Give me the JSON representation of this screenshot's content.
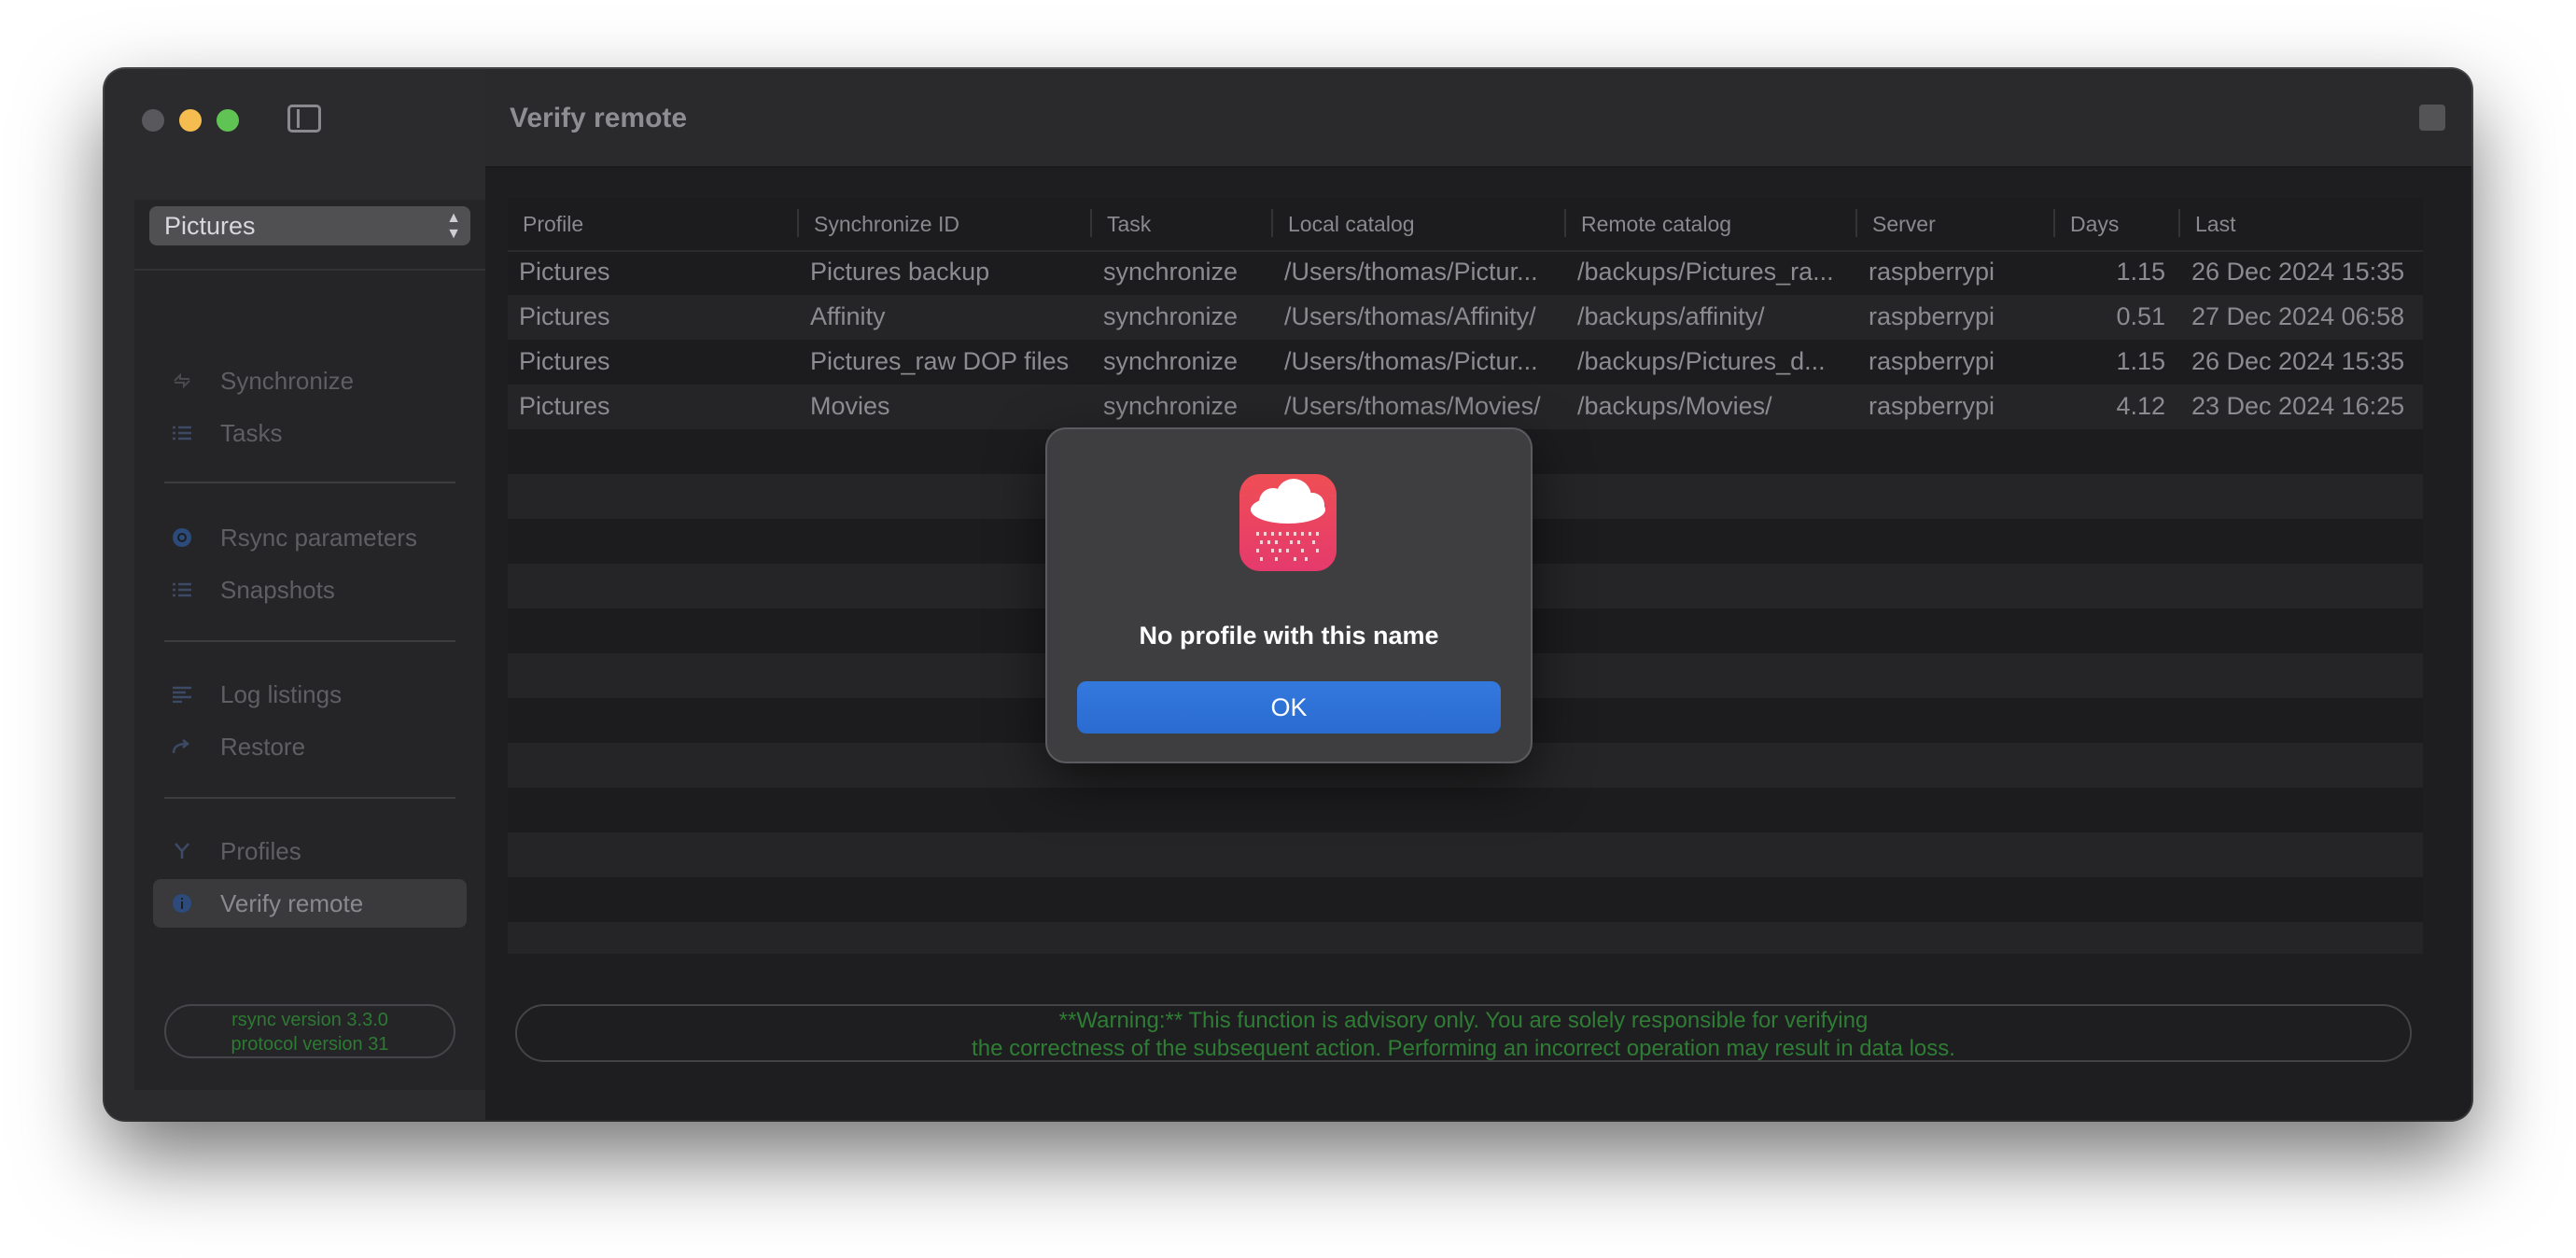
{
  "window": {
    "title": "Verify remote"
  },
  "sidebar": {
    "profile_selector": "Pictures",
    "groups": [
      [
        {
          "label": "Synchronize",
          "icon": "sync-icon"
        },
        {
          "label": "Tasks",
          "icon": "list-icon"
        }
      ],
      [
        {
          "label": "Rsync parameters",
          "icon": "gear-circle-icon"
        },
        {
          "label": "Snapshots",
          "icon": "list-icon"
        }
      ],
      [
        {
          "label": "Log listings",
          "icon": "list-icon"
        },
        {
          "label": "Restore",
          "icon": "restore-arrow-icon"
        }
      ],
      [
        {
          "label": "Profiles",
          "icon": "branch-icon"
        },
        {
          "label": "Verify remote",
          "icon": "info-circle-icon"
        }
      ]
    ],
    "active_item": "Verify remote",
    "rsync_version_line1": "rsync  version 3.3.0",
    "rsync_version_line2": "protocol version 31"
  },
  "table": {
    "columns": [
      "Profile",
      "Synchronize ID",
      "Task",
      "Local catalog",
      "Remote catalog",
      "Server",
      "Days",
      "Last"
    ],
    "rows": [
      [
        "Pictures",
        "Pictures backup",
        "synchronize",
        "/Users/thomas/Pictur...",
        "/backups/Pictures_ra...",
        "raspberrypi",
        "1.15",
        "26 Dec 2024 15:35"
      ],
      [
        "Pictures",
        "Affinity",
        "synchronize",
        "/Users/thomas/Affinity/",
        "/backups/affinity/",
        "raspberrypi",
        "0.51",
        "27 Dec 2024 06:58"
      ],
      [
        "Pictures",
        "Pictures_raw DOP files",
        "synchronize",
        "/Users/thomas/Pictur...",
        "/backups/Pictures_d...",
        "raspberrypi",
        "1.15",
        "26 Dec 2024 15:35"
      ],
      [
        "Pictures",
        "Movies",
        "synchronize",
        "/Users/thomas/Movies/",
        "/backups/Movies/",
        "raspberrypi",
        "4.12",
        "23 Dec 2024 16:25"
      ]
    ]
  },
  "warning": {
    "line1": "**Warning:** This function is advisory only. You are solely responsible for verifying",
    "line2": "the correctness of the subsequent action. Performing an incorrect operation may result in data loss."
  },
  "dialog": {
    "message": "No profile with this name",
    "ok_label": "OK"
  },
  "colors": {
    "accent": "#2f6fd6",
    "warning_text": "#2f7d35",
    "window_bg": "#1e1e20",
    "app_icon": "#e8445f"
  }
}
